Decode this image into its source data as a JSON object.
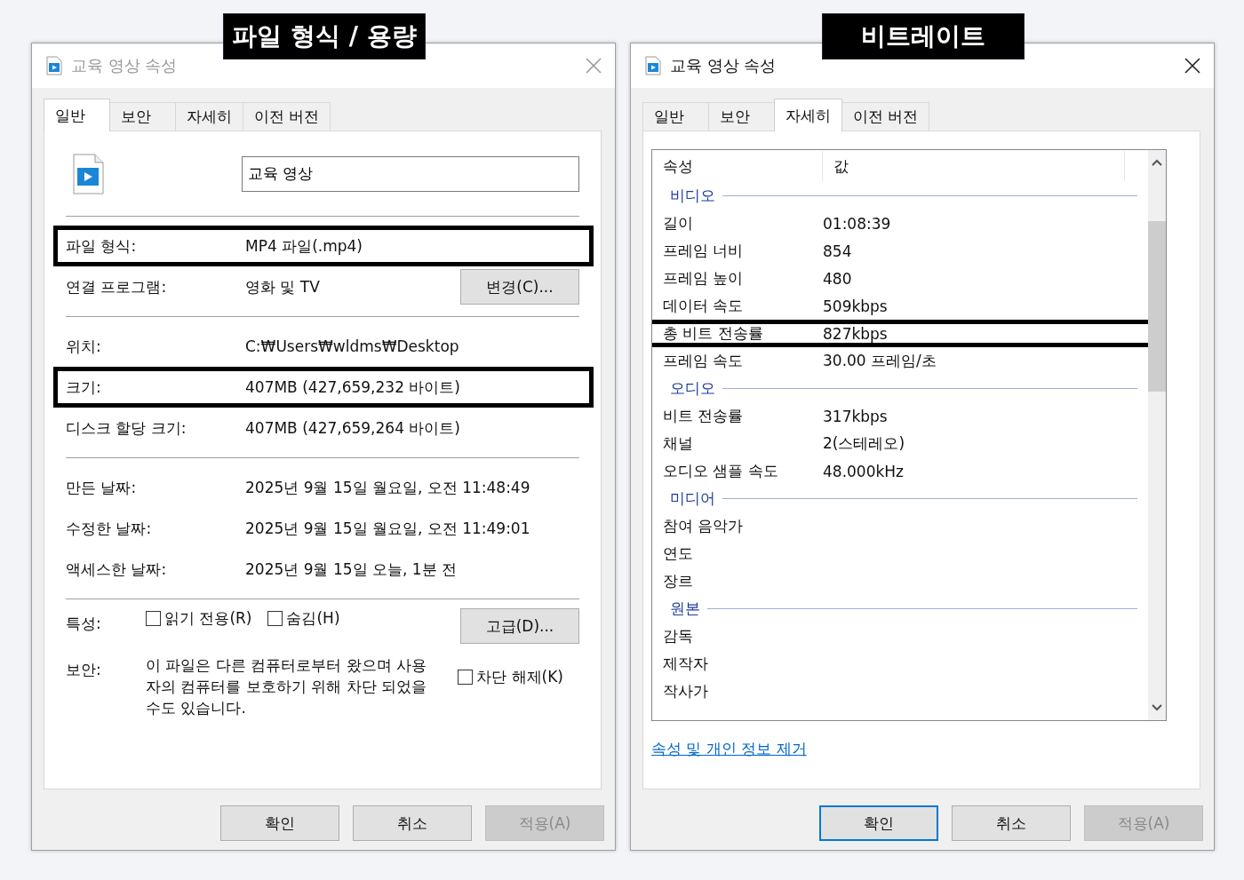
{
  "dialogs": [
    {
      "kind": "general",
      "active": false,
      "title": "교육 영상 속성",
      "callout": "파일 형식 / 용량",
      "tabs": [
        {
          "label": "일반",
          "selected": true
        },
        {
          "label": "보안",
          "selected": false
        },
        {
          "label": "자세히",
          "selected": false
        },
        {
          "label": "이전 버전",
          "selected": false
        }
      ],
      "name_field": {
        "value": "교육 영상"
      },
      "sections": [
        {
          "rows": [
            {
              "label": "파일 형식:",
              "value": "MP4 파일(.mp4)",
              "highlighted": true
            },
            {
              "label": "연결 프로그램:",
              "value": "영화 및 TV",
              "highlighted": false,
              "button": "변경(C)..."
            }
          ]
        },
        {
          "rows": [
            {
              "label": "위치:",
              "value": "C:₩Users₩wldms₩Desktop",
              "highlighted": false
            },
            {
              "label": "크기:",
              "value": "407MB (427,659,232 바이트)",
              "highlighted": true
            },
            {
              "label": "디스크 할당 크기:",
              "value": "407MB (427,659,264 바이트)",
              "highlighted": false
            }
          ]
        },
        {
          "rows": [
            {
              "label": "만든 날짜:",
              "value": "2025년 9월 15일 월요일, 오전 11:48:49",
              "highlighted": false
            },
            {
              "label": "수정한 날짜:",
              "value": "2025년 9월 15일 월요일, 오전 11:49:01",
              "highlighted": false
            },
            {
              "label": "액세스한 날짜:",
              "value": "2025년 9월 15일 오늘, 1분 전",
              "highlighted": false
            }
          ]
        }
      ],
      "attributes": {
        "label": "특성:",
        "checkboxes": [
          {
            "label": "읽기 전용(R)",
            "checked": false
          },
          {
            "label": "숨김(H)",
            "checked": false
          }
        ],
        "button": "고급(D)..."
      },
      "security": {
        "label": "보안:",
        "text": "이 파일은 다른 컴퓨터로부터 왔으며 사용자의 컴퓨터를 보호하기 위해 차단 되었을 수도 있습니다.",
        "checkbox": {
          "label": "차단 해제(K)",
          "checked": false
        }
      },
      "buttons": [
        {
          "label": "확인",
          "default": false,
          "disabled": false
        },
        {
          "label": "취소",
          "default": false,
          "disabled": false
        },
        {
          "label": "적용(A)",
          "default": false,
          "disabled": true
        }
      ]
    },
    {
      "kind": "details",
      "active": true,
      "title": "교육 영상 속성",
      "callout": "비트레이트",
      "tabs": [
        {
          "label": "일반",
          "selected": false
        },
        {
          "label": "보안",
          "selected": false
        },
        {
          "label": "자세히",
          "selected": true
        },
        {
          "label": "이전 버전",
          "selected": false
        }
      ],
      "columns": [
        "속성",
        "값"
      ],
      "items": [
        {
          "kind": "group",
          "label": "비디오"
        },
        {
          "kind": "row",
          "name": "길이",
          "value": "01:08:39",
          "highlighted": false
        },
        {
          "kind": "row",
          "name": "프레임 너비",
          "value": "854",
          "highlighted": false
        },
        {
          "kind": "row",
          "name": "프레임 높이",
          "value": "480",
          "highlighted": false
        },
        {
          "kind": "row",
          "name": "데이터 속도",
          "value": "509kbps",
          "highlighted": false
        },
        {
          "kind": "row",
          "name": "총 비트 전송률",
          "value": "827kbps",
          "highlighted": true
        },
        {
          "kind": "row",
          "name": "프레임 속도",
          "value": "30.00 프레임/초",
          "highlighted": false
        },
        {
          "kind": "group",
          "label": "오디오"
        },
        {
          "kind": "row",
          "name": "비트 전송률",
          "value": "317kbps",
          "highlighted": false
        },
        {
          "kind": "row",
          "name": "채널",
          "value": "2(스테레오)",
          "highlighted": false
        },
        {
          "kind": "row",
          "name": "오디오 샘플 속도",
          "value": "48.000kHz",
          "highlighted": false
        },
        {
          "kind": "group",
          "label": "미디어"
        },
        {
          "kind": "row",
          "name": "참여 음악가",
          "highlighted": false
        },
        {
          "kind": "row",
          "name": "연도",
          "highlighted": false
        },
        {
          "kind": "row",
          "name": "장르",
          "highlighted": false
        },
        {
          "kind": "group",
          "label": "원본"
        },
        {
          "kind": "row",
          "name": "감독",
          "highlighted": false
        },
        {
          "kind": "row",
          "name": "제작자",
          "highlighted": false
        },
        {
          "kind": "row",
          "name": "작사가",
          "highlighted": false
        }
      ],
      "link": "속성 및 개인 정보 제거",
      "buttons": [
        {
          "label": "확인",
          "default": true,
          "disabled": false
        },
        {
          "label": "취소",
          "default": false,
          "disabled": false
        },
        {
          "label": "적용(A)",
          "default": false,
          "disabled": true
        }
      ]
    }
  ]
}
